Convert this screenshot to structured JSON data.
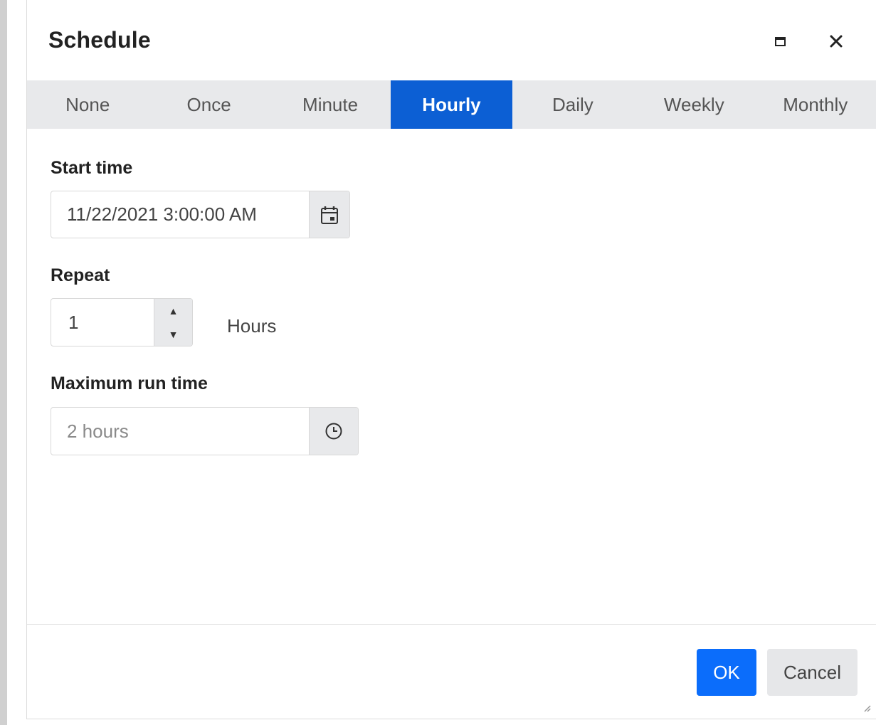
{
  "dialog": {
    "title": "Schedule",
    "maximize_icon": "window-maximize-icon",
    "close_icon": "close-icon",
    "close_glyph": "✕"
  },
  "tabs": [
    {
      "label": "None",
      "active": false
    },
    {
      "label": "Once",
      "active": false
    },
    {
      "label": "Minute",
      "active": false
    },
    {
      "label": "Hourly",
      "active": true
    },
    {
      "label": "Daily",
      "active": false
    },
    {
      "label": "Weekly",
      "active": false
    },
    {
      "label": "Monthly",
      "active": false
    }
  ],
  "start_time": {
    "label": "Start time",
    "value": "11/22/2021 3:00:00 AM",
    "icon": "calendar-icon"
  },
  "repeat": {
    "label": "Repeat",
    "value": "1",
    "unit": "Hours",
    "up_glyph": "▲",
    "down_glyph": "▼"
  },
  "max_run_time": {
    "label": "Maximum run time",
    "placeholder": "2 hours",
    "icon": "clock-icon"
  },
  "footer": {
    "ok_label": "OK",
    "cancel_label": "Cancel"
  },
  "colors": {
    "accent": "#0c5fd4",
    "ok_button": "#0b6dfb",
    "tab_bar": "#e8e9eb"
  }
}
